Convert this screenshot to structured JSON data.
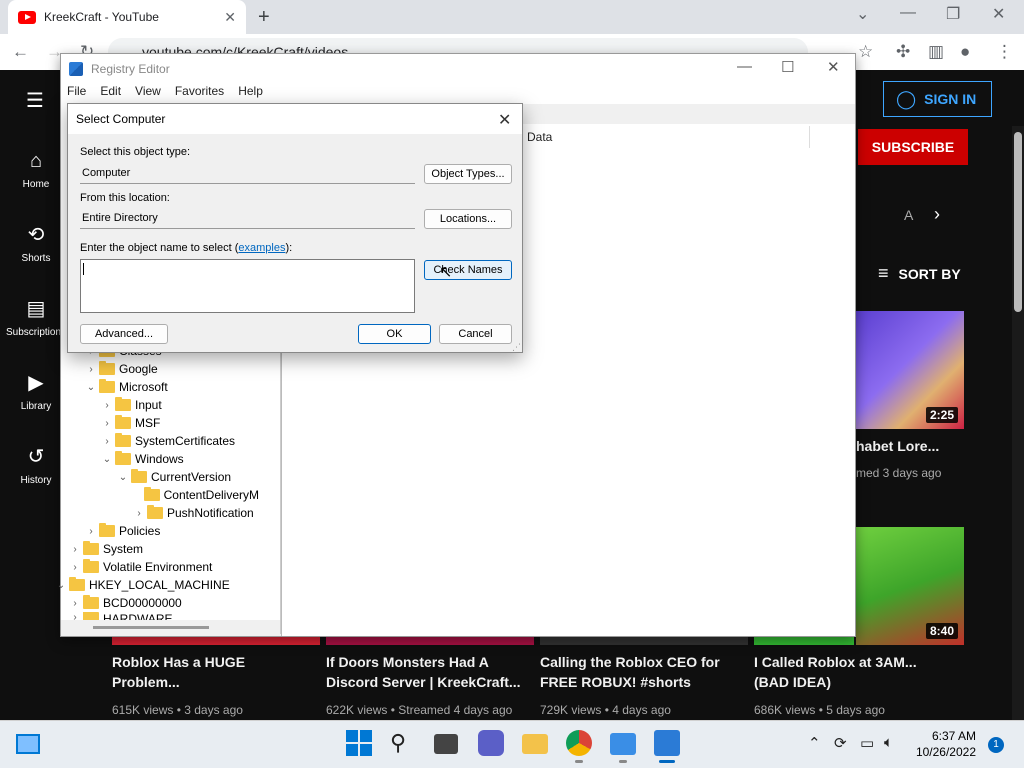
{
  "chrome": {
    "tab_title": "KreekCraft - YouTube",
    "tab_close": "✕",
    "new_tab": "+",
    "address": "youtube.com/c/KreekCraft/videos",
    "win_min": "⌄",
    "win_restore": "—",
    "win_max": "❐",
    "win_close": "✕"
  },
  "youtube": {
    "signin_label": "SIGN IN",
    "subscribe_label": "SUBSCRIBE",
    "sort_label": "SORT BY",
    "chip_text": "A",
    "sidebar": [
      {
        "label": "Home",
        "icon": "⌂"
      },
      {
        "label": "Shorts",
        "icon": "⟲"
      },
      {
        "label": "Subscriptions",
        "icon": "▤"
      },
      {
        "label": "Library",
        "icon": "▶"
      },
      {
        "label": "History",
        "icon": "↺"
      }
    ],
    "right_videos": [
      {
        "duration": "2:25",
        "title": "habet Lore...",
        "meta": "med 3 days ago"
      },
      {
        "duration": "8:40"
      }
    ],
    "bottom_videos": [
      {
        "title": "Roblox Has a HUGE Problem...",
        "meta": "615K views • 3 days ago"
      },
      {
        "title": "If Doors Monsters Had A Discord Server | KreekCraft...",
        "meta": "622K views • Streamed 4 days ago"
      },
      {
        "title": "Calling the Roblox CEO for FREE ROBUX! #shorts",
        "meta": "729K views • 4 days ago"
      },
      {
        "title": "I Called Roblox at 3AM... (BAD IDEA)",
        "meta": "686K views • 5 days ago"
      }
    ]
  },
  "regedit": {
    "title": "Registry Editor",
    "menu": [
      "File",
      "Edit",
      "View",
      "Favorites",
      "Help"
    ],
    "column_data": "Data",
    "tree": [
      {
        "label": "Classes",
        "indent": 1,
        "chevron": "›"
      },
      {
        "label": "Google",
        "indent": 1,
        "chevron": "›"
      },
      {
        "label": "Microsoft",
        "indent": 1,
        "chevron": "⌄"
      },
      {
        "label": "Input",
        "indent": 2,
        "chevron": "›"
      },
      {
        "label": "MSF",
        "indent": 2,
        "chevron": "›"
      },
      {
        "label": "SystemCertificates",
        "indent": 2,
        "chevron": "›"
      },
      {
        "label": "Windows",
        "indent": 2,
        "chevron": "⌄"
      },
      {
        "label": "CurrentVersion",
        "indent": 3,
        "chevron": "⌄"
      },
      {
        "label": "ContentDeliveryM",
        "indent": 4,
        "chevron": ""
      },
      {
        "label": "PushNotification",
        "indent": 4,
        "chevron": "›"
      },
      {
        "label": "Policies",
        "indent": 1,
        "chevron": "›"
      },
      {
        "label": "System",
        "indent": 0,
        "chevron": "›"
      },
      {
        "label": "Volatile Environment",
        "indent": 0,
        "chevron": "›"
      },
      {
        "label": "HKEY_LOCAL_MACHINE",
        "indent": -1,
        "chevron": "⌄"
      },
      {
        "label": "BCD00000000",
        "indent": 0,
        "chevron": "›"
      },
      {
        "label": "HARDWARE",
        "indent": 0,
        "chevron": "›"
      }
    ]
  },
  "dialog": {
    "title": "Select Computer",
    "object_type_label": "Select this object type:",
    "object_type_value": "Computer",
    "object_types_button": "Object Types...",
    "location_label": "From this location:",
    "location_value": "Entire Directory",
    "locations_button": "Locations...",
    "name_label_prefix": "Enter the object name to select (",
    "name_label_link": "examples",
    "name_label_suffix": "):",
    "check_names_button": "Check Names",
    "advanced_button": "Advanced...",
    "ok_button": "OK",
    "cancel_button": "Cancel",
    "close": "✕"
  },
  "taskbar": {
    "time": "6:37 AM",
    "date": "10/26/2022",
    "notifications": "1"
  }
}
